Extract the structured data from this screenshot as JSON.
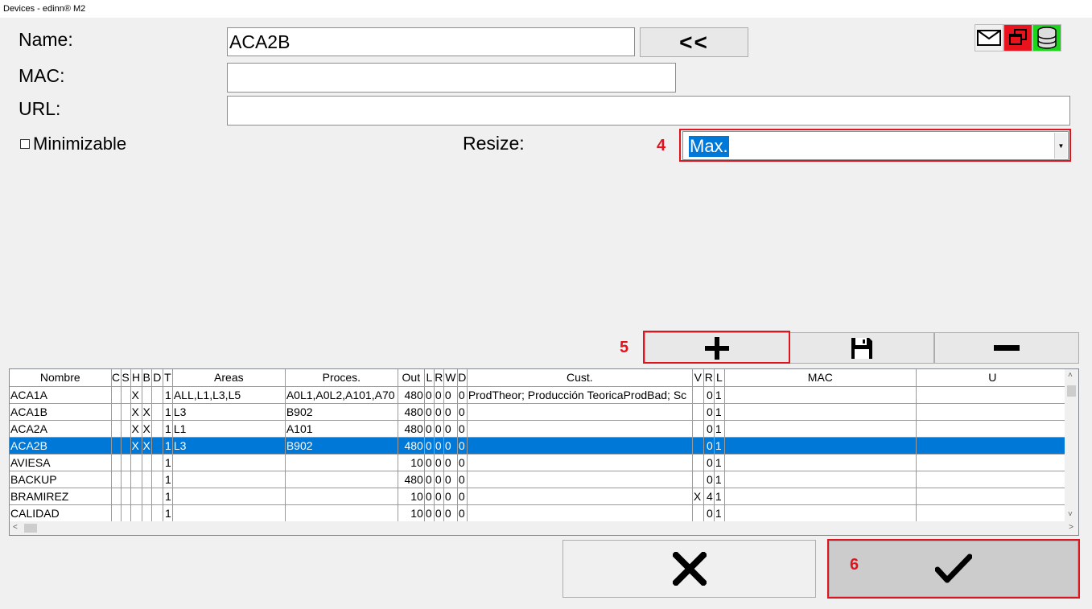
{
  "window": {
    "title": "Devices - edinn® M2"
  },
  "form": {
    "name_label": "Name:",
    "name_value": "ACA2B",
    "back_button": "<<",
    "mac_label": "MAC:",
    "mac_value": "",
    "url_label": "URL:",
    "url_value": "",
    "minimizable_label": "Minimizable",
    "minimizable_checked": false,
    "resize_label": "Resize:",
    "resize_value": "Max."
  },
  "annotations": {
    "a4": "4",
    "a5": "5",
    "a6": "6"
  },
  "toolbar": {
    "icons": [
      "mail-icon",
      "window-icon",
      "database-icon"
    ],
    "window_icon_bg": "#e8131c",
    "database_icon_bg": "#1bd41b"
  },
  "grid": {
    "columns": [
      "Nombre",
      "C",
      "S",
      "H",
      "B",
      "D",
      "T",
      "Areas",
      "Proces.",
      "Out",
      "L",
      "R",
      "W",
      "D",
      "Cust.",
      "V",
      "R",
      "L",
      "MAC",
      "U"
    ],
    "rows": [
      [
        "ACA1A",
        "",
        "",
        "X",
        "",
        "",
        "1",
        "ALL,L1,L3,L5",
        "A0L1,A0L2,A101,A70",
        "480",
        "0",
        "0",
        "0",
        "0",
        "ProdTheor; Producción TeoricaProdBad; Sc",
        "",
        "0",
        "1",
        "",
        ""
      ],
      [
        "ACA1B",
        "",
        "",
        "X",
        "X",
        "",
        "1",
        "L3",
        "B902",
        "480",
        "0",
        "0",
        "0",
        "0",
        "",
        "",
        "0",
        "1",
        "",
        ""
      ],
      [
        "ACA2A",
        "",
        "",
        "X",
        "X",
        "",
        "1",
        "L1",
        "A101",
        "480",
        "0",
        "0",
        "0",
        "0",
        "",
        "",
        "0",
        "1",
        "",
        ""
      ],
      [
        "ACA2B",
        "",
        "",
        "X",
        "X",
        "",
        "1",
        "L3",
        "B902",
        "480",
        "0",
        "0",
        "0",
        "0",
        "",
        "",
        "0",
        "1",
        "",
        ""
      ],
      [
        "AVIESA",
        "",
        "",
        "",
        "",
        "",
        "1",
        "",
        "",
        "10",
        "0",
        "0",
        "0",
        "0",
        "",
        "",
        "0",
        "1",
        "",
        ""
      ],
      [
        "BACKUP",
        "",
        "",
        "",
        "",
        "",
        "1",
        "",
        "",
        "480",
        "0",
        "0",
        "0",
        "0",
        "",
        "",
        "0",
        "1",
        "",
        ""
      ],
      [
        "BRAMIREZ",
        "",
        "",
        "",
        "",
        "",
        "1",
        "",
        "",
        "10",
        "0",
        "0",
        "0",
        "0",
        "",
        "X",
        "4",
        "1",
        "",
        ""
      ],
      [
        "CALIDAD",
        "",
        "",
        "",
        "",
        "",
        "1",
        "",
        "",
        "10",
        "0",
        "0",
        "0",
        "0",
        "",
        "",
        "0",
        "1",
        "",
        ""
      ]
    ],
    "selected_row": 3
  },
  "colors": {
    "accent": "#0078d7",
    "annotation": "#e0141e"
  }
}
